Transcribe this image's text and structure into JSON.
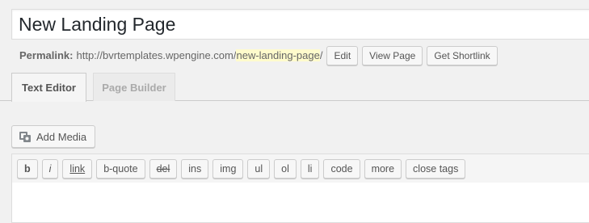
{
  "title": {
    "value": "New Landing Page"
  },
  "permalink": {
    "label": "Permalink:",
    "base_url": "http://bvrtemplates.wpengine.com/",
    "slug": "new-landing-page",
    "trailing": "/",
    "buttons": {
      "edit": "Edit",
      "view": "View Page",
      "shortlink": "Get Shortlink"
    }
  },
  "tabs": {
    "text_editor": "Text Editor",
    "page_builder": "Page Builder"
  },
  "media": {
    "add_label": "Add Media",
    "icon": "media-icon"
  },
  "quicktags": [
    "b",
    "i",
    "link",
    "b-quote",
    "del",
    "ins",
    "img",
    "ul",
    "ol",
    "li",
    "code",
    "more",
    "close tags"
  ]
}
